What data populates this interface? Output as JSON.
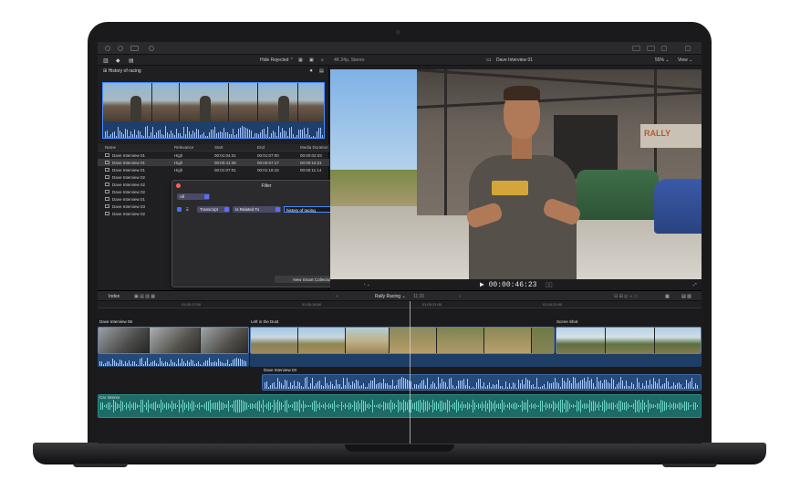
{
  "app": {
    "toolbar": {
      "hide_rejected": "Hide Rejected ⌃",
      "format": "4K 24p, Stereo",
      "clip_title": "Dave Interview 01",
      "zoom": "55% ⌄",
      "view": "View ⌄"
    },
    "browser": {
      "title": "History of racing",
      "columns": [
        "Name",
        "Relevance",
        "Start",
        "End",
        "Media Duration"
      ],
      "rows": [
        {
          "name": "Dave Interview 01",
          "relevance": "High",
          "start": "00:01:04:31",
          "end": "00:01:07:00",
          "dur": "00:00:02:03"
        },
        {
          "name": "Dave Interview 01",
          "relevance": "High",
          "start": "00:00:41:39",
          "end": "00:00:57:17",
          "dur": "00:00:16:21"
        },
        {
          "name": "Dave Interview 01",
          "relevance": "High",
          "start": "00:01:07:01",
          "end": "00:01:18:15",
          "dur": "00:00:11:14"
        },
        {
          "name": "Dave Interview 02",
          "relevance": "",
          "start": "",
          "end": "",
          "dur": ""
        },
        {
          "name": "Dave Interview 02",
          "relevance": "",
          "start": "",
          "end": "",
          "dur": ""
        },
        {
          "name": "Dave Interview 02",
          "relevance": "",
          "start": "",
          "end": "",
          "dur": ""
        },
        {
          "name": "Dave Interview 01",
          "relevance": "",
          "start": "",
          "end": "",
          "dur": ""
        },
        {
          "name": "Dave Interview 03",
          "relevance": "",
          "start": "",
          "end": "",
          "dur": ""
        },
        {
          "name": "Dave Interview 02",
          "relevance": "",
          "start": "",
          "end": "",
          "dur": ""
        }
      ]
    },
    "filter": {
      "title": "Filter",
      "match": "All",
      "plus": "+",
      "rule_field": "Transcript",
      "rule_op": "Is Related To",
      "rule_value": "history of racing",
      "new_collection": "New Smart Collection"
    },
    "viewer": {
      "timecode": "▶ 00:00:46:23",
      "sign_text": "RALLY"
    },
    "timeline": {
      "index": "Index",
      "project": "Rally Racing ⌄",
      "project_time": "11:20",
      "ruler": [
        "01:00:17:00",
        "01:00:18:00",
        "01:00:21:00",
        "01:00:22:00"
      ],
      "clips": {
        "c1": "Dave Interview 06",
        "c2": "Left in the Dust",
        "c3": "Scene Shot",
        "connected": "Dave Interview 03",
        "music": "Car Interior"
      }
    }
  }
}
